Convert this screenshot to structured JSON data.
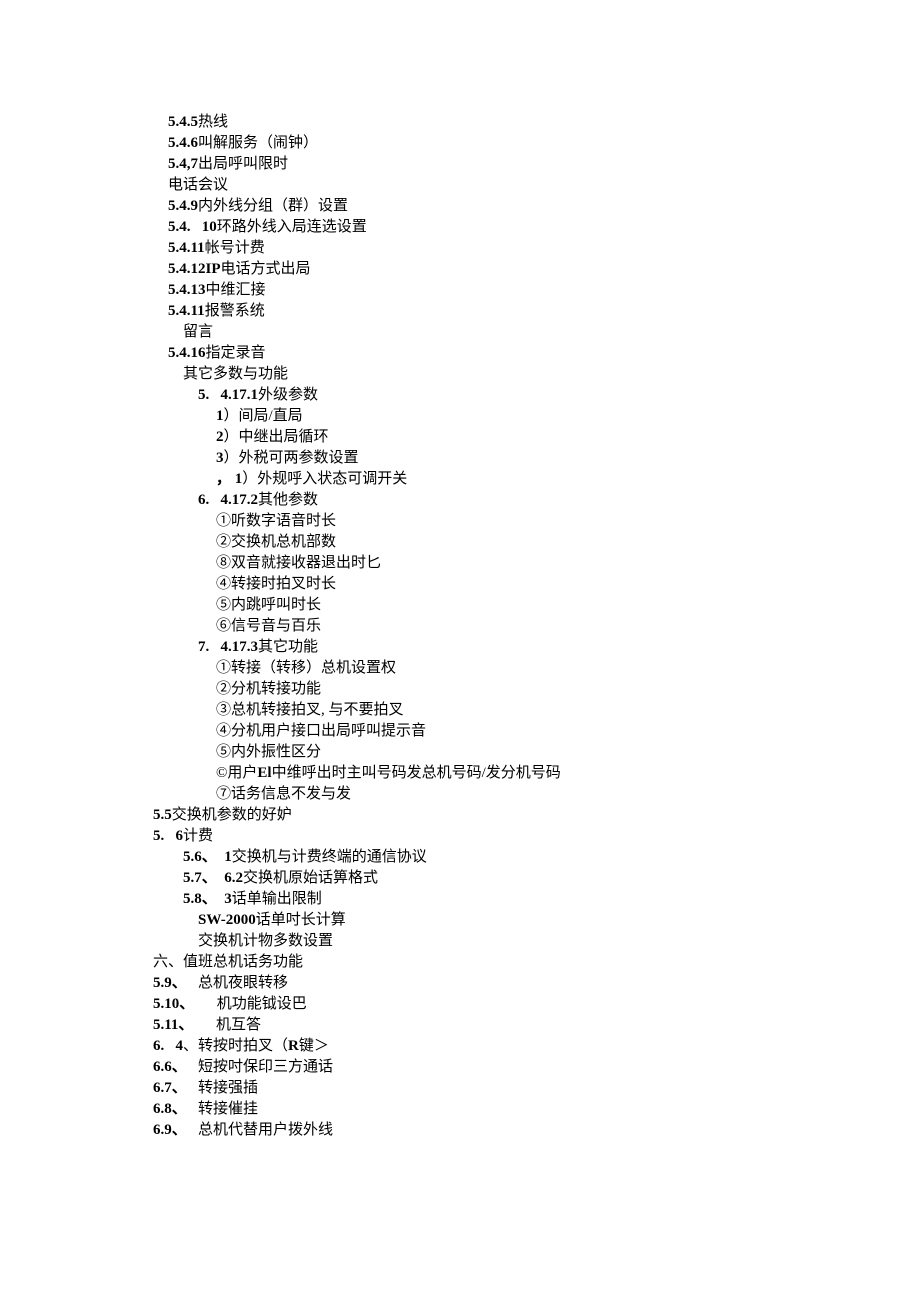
{
  "lines": [
    {
      "indent": 0,
      "segments": [
        {
          "bold": true,
          "text": "5.4.5"
        },
        {
          "bold": false,
          "text": "热线"
        }
      ]
    },
    {
      "indent": 0,
      "segments": [
        {
          "bold": true,
          "text": "5.4.6"
        },
        {
          "bold": false,
          "text": "叫解服务（闹钟）"
        }
      ]
    },
    {
      "indent": 0,
      "segments": [
        {
          "bold": true,
          "text": "5.4,7"
        },
        {
          "bold": false,
          "text": "出局呼叫限时"
        }
      ]
    },
    {
      "indent": 0,
      "segments": [
        {
          "bold": false,
          "text": "电话会议"
        }
      ]
    },
    {
      "indent": 0,
      "segments": [
        {
          "bold": true,
          "text": "5.4.9"
        },
        {
          "bold": false,
          "text": "内外线分组（群）设置"
        }
      ]
    },
    {
      "indent": 0,
      "segments": [
        {
          "bold": true,
          "text": "5.4.   10"
        },
        {
          "bold": false,
          "text": "环路外线入局连选设置"
        }
      ]
    },
    {
      "indent": 0,
      "segments": [
        {
          "bold": true,
          "text": "5.4.11"
        },
        {
          "bold": false,
          "text": "帐号计费"
        }
      ]
    },
    {
      "indent": 0,
      "segments": [
        {
          "bold": true,
          "text": "5.4.12IP"
        },
        {
          "bold": false,
          "text": "电话方式出局"
        }
      ]
    },
    {
      "indent": 0,
      "segments": [
        {
          "bold": true,
          "text": "5.4.13"
        },
        {
          "bold": false,
          "text": "中维汇接"
        }
      ]
    },
    {
      "indent": 0,
      "segments": [
        {
          "bold": true,
          "text": "5.4.11"
        },
        {
          "bold": false,
          "text": "报警系统"
        }
      ]
    },
    {
      "indent": 1,
      "segments": [
        {
          "bold": false,
          "text": "留言"
        }
      ]
    },
    {
      "indent": 0,
      "segments": [
        {
          "bold": true,
          "text": "5.4.16"
        },
        {
          "bold": false,
          "text": "指定录音"
        }
      ]
    },
    {
      "indent": 1,
      "segments": [
        {
          "bold": false,
          "text": "其它多数与功能"
        }
      ]
    },
    {
      "indent": 2,
      "segments": [
        {
          "bold": true,
          "text": "5.   4.17.1"
        },
        {
          "bold": false,
          "text": "外级参数"
        }
      ]
    },
    {
      "indent": 3,
      "segments": [
        {
          "bold": true,
          "text": "1"
        },
        {
          "bold": false,
          "text": "）间局/直局"
        }
      ]
    },
    {
      "indent": 3,
      "segments": [
        {
          "bold": true,
          "text": "2"
        },
        {
          "bold": false,
          "text": "）中继出局循环"
        }
      ]
    },
    {
      "indent": 3,
      "segments": [
        {
          "bold": true,
          "text": "3"
        },
        {
          "bold": false,
          "text": "）外税可两参数设置"
        }
      ]
    },
    {
      "indent": 3,
      "segments": [
        {
          "bold": true,
          "text": "， 1"
        },
        {
          "bold": false,
          "text": "）外规呼入状态可调开关"
        }
      ]
    },
    {
      "indent": 2,
      "segments": [
        {
          "bold": true,
          "text": "6.   4.17.2"
        },
        {
          "bold": false,
          "text": "其他参数"
        }
      ]
    },
    {
      "indent": 3,
      "segments": [
        {
          "bold": false,
          "text": "①听数字语音时长"
        }
      ]
    },
    {
      "indent": 3,
      "segments": [
        {
          "bold": false,
          "text": "②交换机总机部数"
        }
      ]
    },
    {
      "indent": 3,
      "segments": [
        {
          "bold": false,
          "text": "⑧双音就接收器退出时匕"
        }
      ]
    },
    {
      "indent": 3,
      "segments": [
        {
          "bold": false,
          "text": "④转接时拍叉时长"
        }
      ]
    },
    {
      "indent": 3,
      "segments": [
        {
          "bold": false,
          "text": "⑤内跳呼叫时长"
        }
      ]
    },
    {
      "indent": 3,
      "segments": [
        {
          "bold": false,
          "text": "⑥信号音与百乐"
        }
      ]
    },
    {
      "indent": 2,
      "segments": [
        {
          "bold": true,
          "text": "7.   4.17.3"
        },
        {
          "bold": false,
          "text": "其它功能"
        }
      ]
    },
    {
      "indent": 3,
      "segments": [
        {
          "bold": false,
          "text": "①转接（转移）总机设置权"
        }
      ]
    },
    {
      "indent": 3,
      "segments": [
        {
          "bold": false,
          "text": "②分机转接功能"
        }
      ]
    },
    {
      "indent": 3,
      "segments": [
        {
          "bold": false,
          "text": "③总机转接拍叉, 与不要拍叉"
        }
      ]
    },
    {
      "indent": 3,
      "segments": [
        {
          "bold": false,
          "text": "④分机用户接口出局呼叫提示音"
        }
      ]
    },
    {
      "indent": 3,
      "segments": [
        {
          "bold": false,
          "text": "⑤内外振性区分"
        }
      ]
    },
    {
      "indent": 3,
      "segments": [
        {
          "bold": false,
          "text": "©用户"
        },
        {
          "bold": true,
          "text": "El"
        },
        {
          "bold": false,
          "text": "中维呼出时主叫号码发总机号码/发分机号码"
        }
      ]
    },
    {
      "indent": 3,
      "segments": [
        {
          "bold": false,
          "text": "⑦话务信息不发与发"
        }
      ]
    },
    {
      "indent": -1,
      "segments": [
        {
          "bold": true,
          "text": "5.5"
        },
        {
          "bold": false,
          "text": "交换机参数的好妒"
        }
      ]
    },
    {
      "indent": -1,
      "segments": [
        {
          "bold": true,
          "text": "5.   6"
        },
        {
          "bold": false,
          "text": "计费"
        }
      ]
    },
    {
      "indent": 1,
      "segments": [
        {
          "bold": true,
          "text": "5.6、  1"
        },
        {
          "bold": false,
          "text": "交换机与计费终端的通信协议"
        }
      ]
    },
    {
      "indent": 1,
      "segments": [
        {
          "bold": true,
          "text": "5.7、  6.2"
        },
        {
          "bold": false,
          "text": "交换机原始话箅格式"
        }
      ]
    },
    {
      "indent": 1,
      "segments": [
        {
          "bold": true,
          "text": "5.8、  3"
        },
        {
          "bold": false,
          "text": "话单输出限制"
        }
      ]
    },
    {
      "indent": 2,
      "segments": [
        {
          "bold": true,
          "text": "SW-2000"
        },
        {
          "bold": false,
          "text": "话单吋长计算"
        }
      ]
    },
    {
      "indent": 2,
      "segments": [
        {
          "bold": false,
          "text": "交换机计物多数设置"
        }
      ]
    },
    {
      "indent": -1,
      "segments": [
        {
          "bold": false,
          "text": "六、值班总机话务功能"
        }
      ]
    },
    {
      "indent": -1,
      "segments": [
        {
          "bold": true,
          "text": "5.9、   "
        },
        {
          "bold": false,
          "text": "总机夜眼转移"
        }
      ]
    },
    {
      "indent": -1,
      "segments": [
        {
          "bold": true,
          "text": "5.10、      "
        },
        {
          "bold": false,
          "text": "机功能钺设巴"
        }
      ]
    },
    {
      "indent": -1,
      "segments": [
        {
          "bold": true,
          "text": "5.11、      "
        },
        {
          "bold": false,
          "text": "机互答"
        }
      ]
    },
    {
      "indent": -1,
      "segments": [
        {
          "bold": true,
          "text": "6.   4"
        },
        {
          "bold": false,
          "text": "、转按时拍叉（"
        },
        {
          "bold": true,
          "text": "R"
        },
        {
          "bold": false,
          "text": "键＞"
        }
      ]
    },
    {
      "indent": -1,
      "segments": [
        {
          "bold": true,
          "text": "6.6、   "
        },
        {
          "bold": false,
          "text": "短按吋保印三方通话"
        }
      ]
    },
    {
      "indent": -1,
      "segments": [
        {
          "bold": true,
          "text": "6.7、   "
        },
        {
          "bold": false,
          "text": "转接强插"
        }
      ]
    },
    {
      "indent": -1,
      "segments": [
        {
          "bold": true,
          "text": "6.8、   "
        },
        {
          "bold": false,
          "text": "转接催挂"
        }
      ]
    },
    {
      "indent": -1,
      "segments": [
        {
          "bold": true,
          "text": "6.9、   "
        },
        {
          "bold": false,
          "text": "总机代替用户拨外线"
        }
      ]
    }
  ]
}
